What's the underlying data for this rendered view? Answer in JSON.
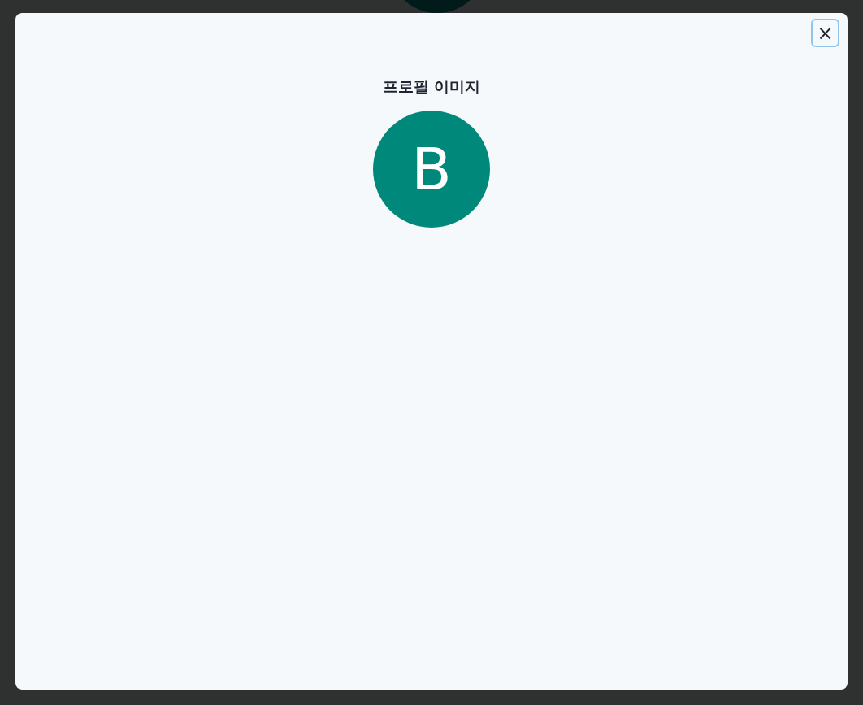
{
  "dialog": {
    "title": "프로필 이미지",
    "close": "×",
    "avatar": {
      "initial": "B",
      "color": "#00897b"
    }
  }
}
